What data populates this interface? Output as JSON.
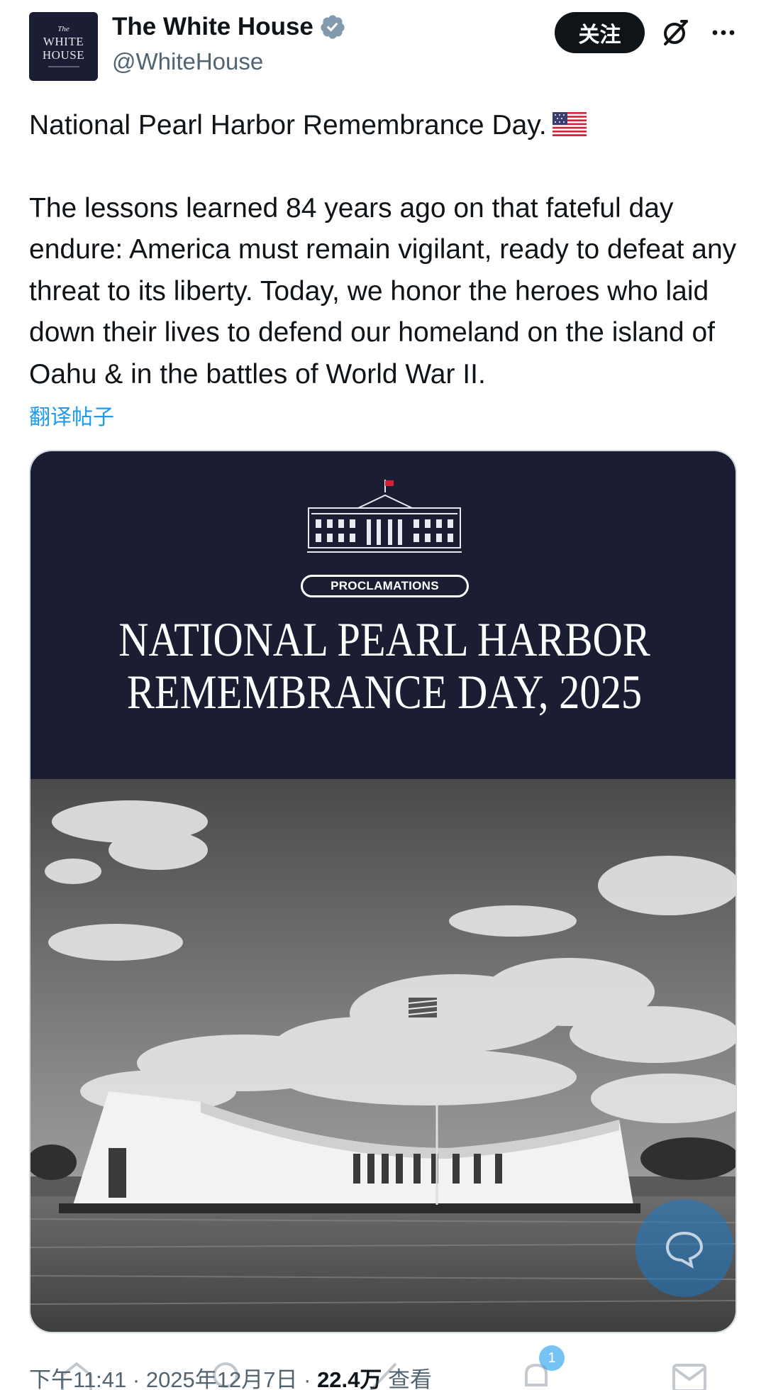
{
  "account": {
    "display_name": "The White House",
    "handle": "@WhiteHouse",
    "avatar": {
      "line1": "The",
      "line2": "WHITE",
      "line3": "HOUSE"
    },
    "verified_color": "#829aab"
  },
  "header": {
    "follow_label": "关注",
    "grok_icon": "grok-icon",
    "more_icon": "more-icon"
  },
  "tweet": {
    "line1": "National Pearl Harbor Remembrance Day.",
    "body": "The lessons learned 84 years ago on that fateful day endure: America must remain vigilant, ready to defeat any threat to its liberty. Today, we honor the heroes who laid down their lives to defend our homeland on the island of Oahu & in the battles of World War II.",
    "translate_label": "翻译帖子"
  },
  "media": {
    "badge": "PROCLAMATIONS",
    "headline_line1": "NATIONAL PEARL HARBOR",
    "headline_line2": "REMEMBRANCE DAY, 2025",
    "top_color": "#1b1d33"
  },
  "meta": {
    "time": "下午11:41 · 2025年12月7日 · ",
    "views": "22.4万",
    "views_label": " 查看"
  },
  "nav": {
    "notification_count": "1"
  },
  "colors": {
    "accent": "#1d9bf0",
    "text": "#0f1419",
    "muted": "#536471"
  }
}
